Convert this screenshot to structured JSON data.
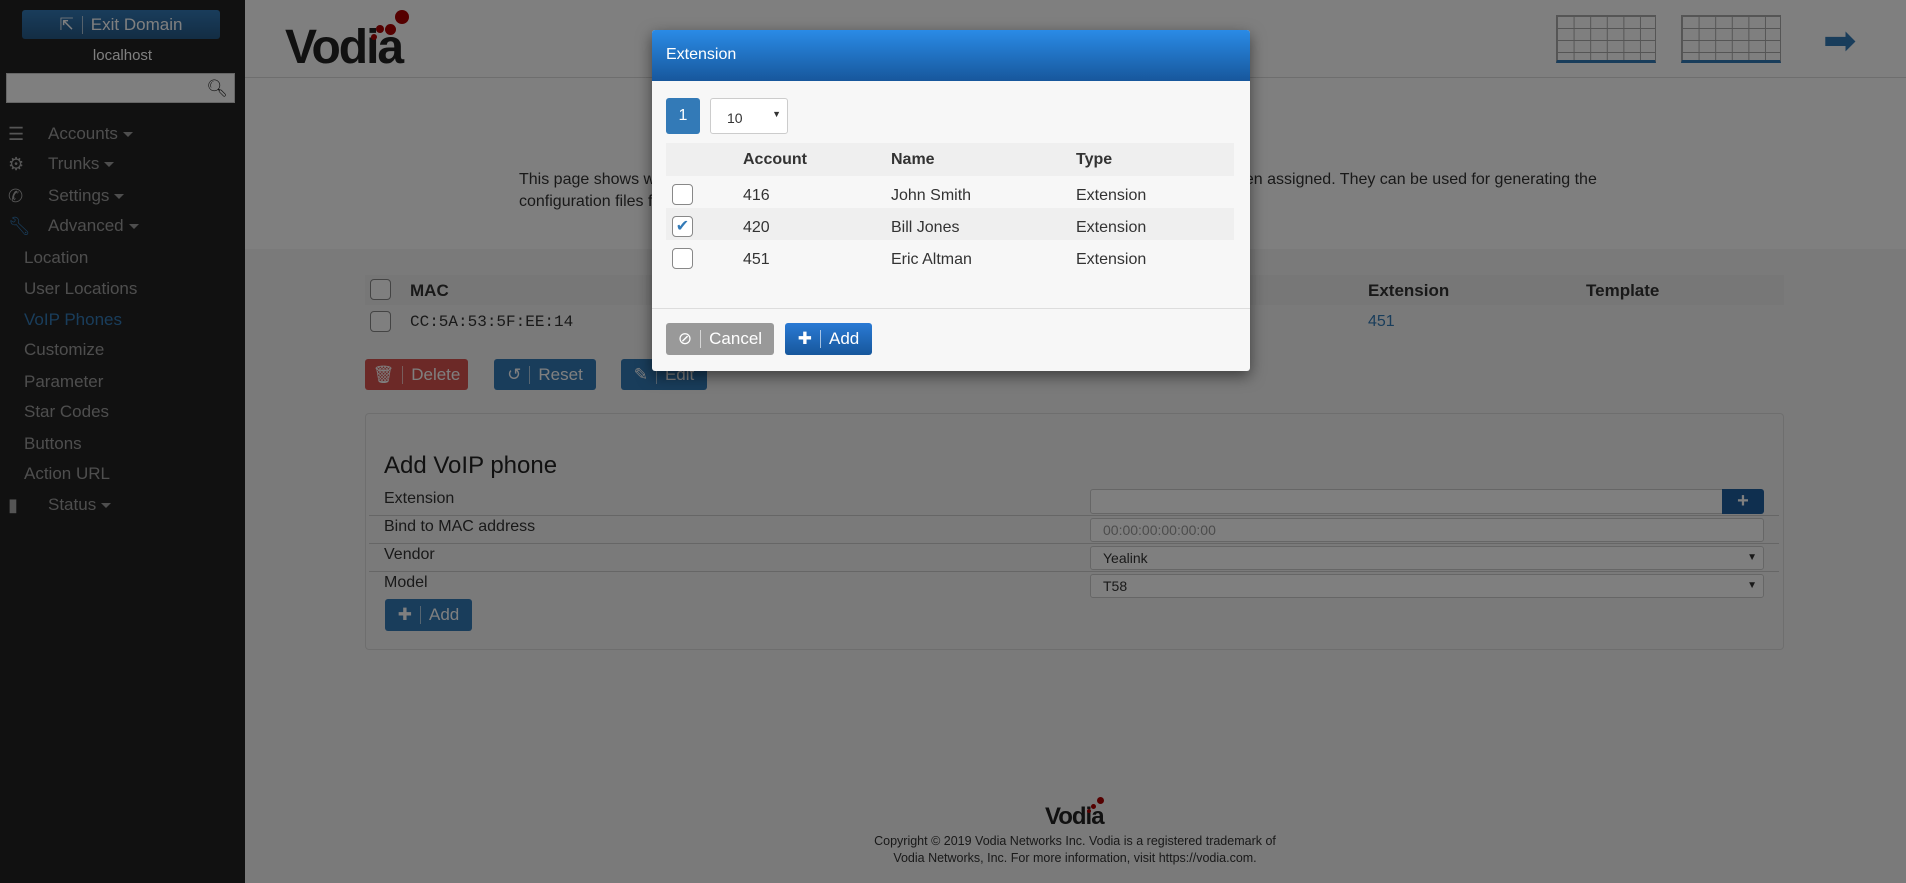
{
  "sidebar": {
    "exit_label": "Exit Domain",
    "domain": "localhost",
    "search_placeholder": "",
    "items": [
      {
        "label": "Accounts",
        "icon": "list-icon"
      },
      {
        "label": "Trunks",
        "icon": "gears-icon"
      },
      {
        "label": "Settings",
        "icon": "phone-icon"
      },
      {
        "label": "Advanced",
        "icon": "wrench-icon"
      }
    ],
    "subitems": [
      "Location",
      "User Locations",
      "VoIP Phones",
      "Customize",
      "Parameter",
      "Star Codes",
      "Buttons",
      "Action URL"
    ],
    "status_label": "Status",
    "active": "VoIP Phones"
  },
  "header": {
    "logo": "Vodia"
  },
  "page": {
    "desc_fragment_1": "This page shows w",
    "desc_fragment_2": "configuration files f",
    "desc_fragment_3": "een assigned. They can be used for generating the"
  },
  "phones_table": {
    "headers": {
      "mac": "MAC",
      "extension": "Extension",
      "template": "Template"
    },
    "rows": [
      {
        "mac": "CC:5A:53:5F:EE:14",
        "extension": "451",
        "template": ""
      }
    ]
  },
  "actions": {
    "delete": "Delete",
    "reset": "Reset",
    "edit": "Edit"
  },
  "add_form": {
    "title": "Add VoIP phone",
    "extension_label": "Extension",
    "extension_value": "",
    "mac_label": "Bind to MAC address",
    "mac_placeholder": "00:00:00:00:00:00",
    "vendor_label": "Vendor",
    "vendor_value": "Yealink",
    "model_label": "Model",
    "model_value": "T58",
    "add_label": "Add"
  },
  "footer": {
    "logo": "Vodia",
    "line1": "Copyright © 2019 Vodia Networks Inc. Vodia is a registered trademark of",
    "line2": "Vodia Networks, Inc. For more information, visit https://vodia.com."
  },
  "modal": {
    "title": "Extension",
    "page": "1",
    "page_size": "10",
    "headers": [
      "Account",
      "Name",
      "Type"
    ],
    "rows": [
      {
        "account": "416",
        "name": "John Smith",
        "type": "Extension",
        "checked": false
      },
      {
        "account": "420",
        "name": "Bill Jones",
        "type": "Extension",
        "checked": true
      },
      {
        "account": "451",
        "name": "Eric Altman",
        "type": "Extension",
        "checked": false
      }
    ],
    "cancel": "Cancel",
    "add": "Add"
  },
  "colors": {
    "primary": "#337ab7",
    "danger": "#d9534f",
    "modal_header": "#1e6fc4",
    "sidebar": "#222222",
    "logo_dots": "#aa0000"
  }
}
